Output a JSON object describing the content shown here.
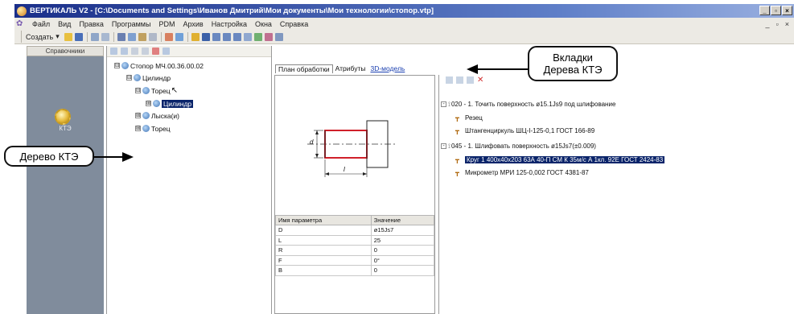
{
  "window": {
    "title": "ВЕРТИКАЛЬ V2 - [C:\\Documents and Settings\\Иванов Дмитрий\\Мои документы\\Мои технологии\\стопор.vtp]",
    "controls": [
      "_",
      "▫",
      "×"
    ]
  },
  "menu": {
    "items": [
      "Файл",
      "Вид",
      "Правка",
      "Программы",
      "PDM",
      "Архив",
      "Настройка",
      "Окна",
      "Справка"
    ],
    "mdi_controls": [
      "_",
      "▫",
      "×"
    ]
  },
  "toolbar": {
    "create_label": "Создать",
    "create_arrow": "▾"
  },
  "sidebar": {
    "header": "Справочники",
    "item_label": "КТЭ"
  },
  "tree": {
    "nodes": [
      {
        "label": "Стопор  МЧ.00.36.00.02",
        "expander": "⊟"
      },
      {
        "label": "Цилиндр",
        "expander": "⊟"
      },
      {
        "label": "Торец",
        "expander": "⊟"
      },
      {
        "label": "Цилиндр",
        "expander": "⊞"
      },
      {
        "label": "Лыска(и)",
        "expander": "⊞"
      },
      {
        "label": "Торец",
        "expander": "⊞"
      }
    ]
  },
  "tabs": [
    {
      "label": "План обработки"
    },
    {
      "label": "Атрибуты"
    },
    {
      "label": "3D-модель"
    }
  ],
  "drawing": {
    "dim_d": "d",
    "dim_l": "l"
  },
  "params": {
    "headers": [
      "Имя параметра",
      "Значение"
    ],
    "rows": [
      {
        "name": "D",
        "value": "ø15Js7"
      },
      {
        "name": "L",
        "value": "25"
      },
      {
        "name": "R",
        "value": "0"
      },
      {
        "name": "F",
        "value": "0°"
      },
      {
        "name": "B",
        "value": "0"
      }
    ]
  },
  "operations": [
    {
      "text": "020 - 1.  Точить  поверхность  ø15.1Js9  под  шлифование",
      "kind": "op"
    },
    {
      "text": "Резец",
      "kind": "tool"
    },
    {
      "text": "Штангенциркуль  ШЦ-I-125-0,1  ГОСТ  166-89",
      "kind": "tool"
    },
    {
      "text": "045 - 1.  Шлифовать  поверхность  ø15Js7(±0.009)",
      "kind": "op"
    },
    {
      "text": "Круг  1  400x40x203  63А  40-П  СМ  К  35м/с  А  1кл.  92Е  ГОСТ  2424-83",
      "kind": "tool-selected"
    },
    {
      "text": "Микрометр  МРИ  125-0,002  ГОСТ  4381-87",
      "kind": "tool"
    }
  ],
  "annotations": {
    "callout_tabs": "Вкладки\nДерева КТЭ",
    "callout_tree": "Дерево КТЭ"
  },
  "colors": {
    "titlebar_start": "#1a2f8a",
    "selection": "#0a246a",
    "sidebar": "#808c9c",
    "drawing_red": "#d0202a"
  }
}
